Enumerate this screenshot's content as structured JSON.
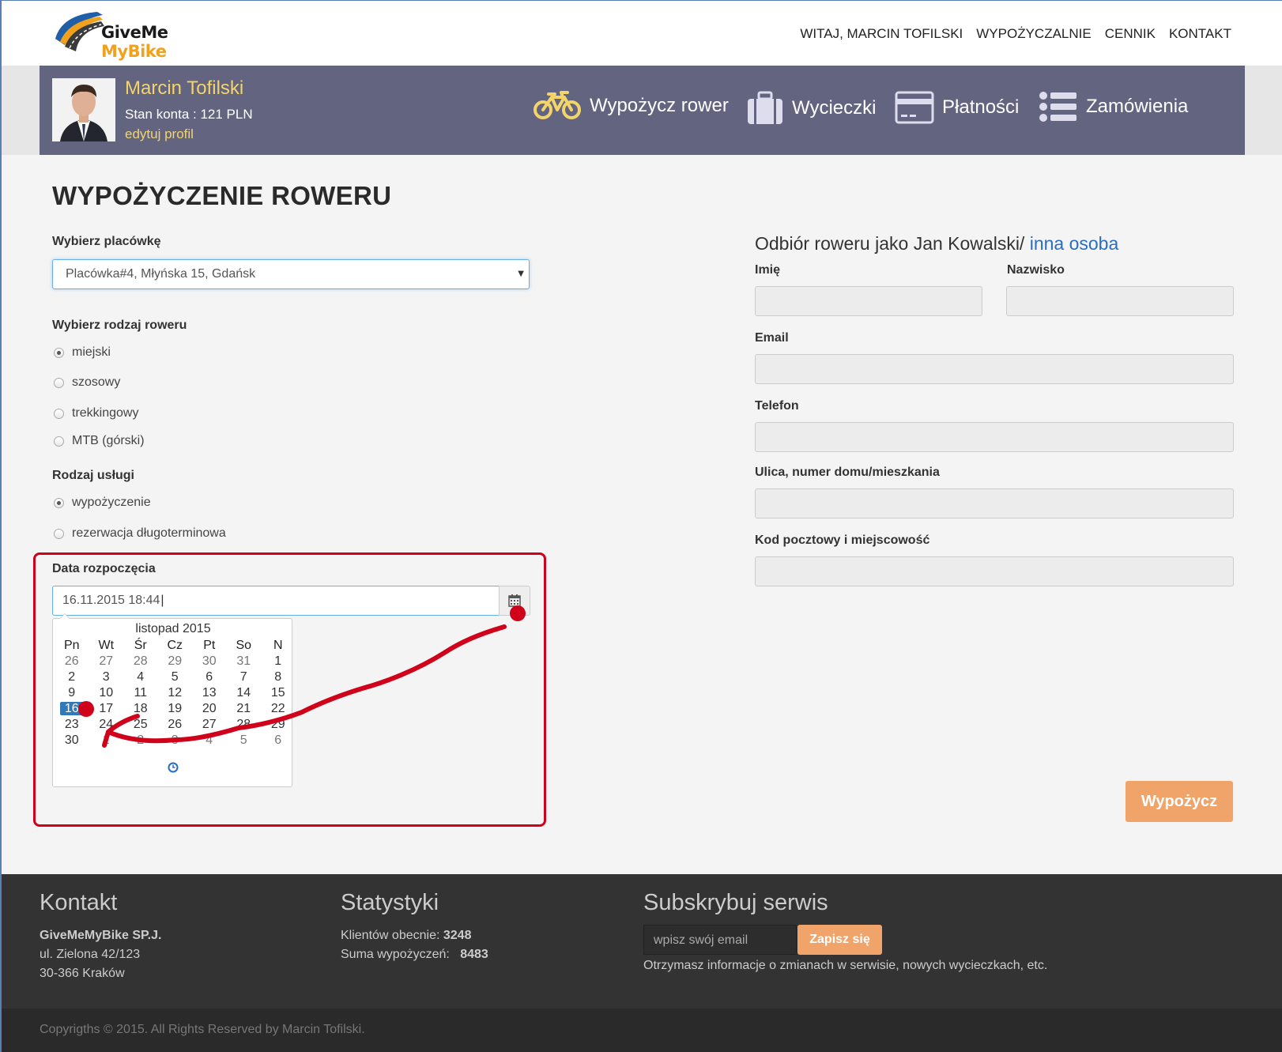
{
  "brand": {
    "line1": "GiveMe",
    "line2": "MyBike"
  },
  "topnav": [
    "WITAJ, MARCIN TOFILSKI",
    "WYPOŻYCZALNIE",
    "CENNIK",
    "KONTAKT"
  ],
  "user": {
    "name": "Marcin Tofilski",
    "balance": "Stan konta : 121 PLN",
    "edit": "edytuj profil"
  },
  "usernav": [
    {
      "label": "Wypożycz rower",
      "icon": "bicycle-icon"
    },
    {
      "label": "Wycieczki",
      "icon": "suitcase-icon"
    },
    {
      "label": "Płatności",
      "icon": "credit-card-icon"
    },
    {
      "label": "Zamówienia",
      "icon": "list-icon"
    }
  ],
  "page": {
    "title": "WYPOŻYCZENIE ROWERU"
  },
  "branch": {
    "label": "Wybierz placówkę",
    "value": "Placówka#4, Młyńska 15, Gdańsk"
  },
  "bike_type": {
    "label": "Wybierz rodzaj roweru",
    "options": [
      "miejski",
      "szosowy",
      "trekkingowy",
      "MTB (górski)"
    ],
    "selected": "miejski"
  },
  "service": {
    "label": "Rodzaj usługi",
    "options": [
      "wypożyczenie",
      "rezerwacja długoterminowa"
    ],
    "selected": "wypożyczenie"
  },
  "start_date": {
    "label": "Data rozpoczęcia",
    "value": "16.11.2015 18:44"
  },
  "calendar": {
    "month": "listopad 2015",
    "weekdays": [
      "Pn",
      "Wt",
      "Śr",
      "Cz",
      "Pt",
      "So",
      "N"
    ],
    "weeks": [
      [
        "26",
        "27",
        "28",
        "29",
        "30",
        "31",
        "1"
      ],
      [
        "2",
        "3",
        "4",
        "5",
        "6",
        "7",
        "8"
      ],
      [
        "9",
        "10",
        "11",
        "12",
        "13",
        "14",
        "15"
      ],
      [
        "16",
        "17",
        "18",
        "19",
        "20",
        "21",
        "22"
      ],
      [
        "23",
        "24",
        "25",
        "26",
        "27",
        "28",
        "29"
      ],
      [
        "30",
        "1",
        "2",
        "3",
        "4",
        "5",
        "6"
      ]
    ],
    "selected": "16"
  },
  "pickup": {
    "title": "Odbiór roweru jako Jan Kowalski/ ",
    "other_link": "inna osoba",
    "fields": {
      "first_name": "Imię",
      "last_name": "Nazwisko",
      "email": "Email",
      "phone": "Telefon",
      "street": "Ulica, numer domu/mieszkania",
      "postal": "Kod pocztowy i miejscowość"
    }
  },
  "submit_label": "Wypożycz",
  "footer": {
    "contact_title": "Kontakt",
    "company": "GiveMeMyBike SP.J.",
    "street": "ul. Zielona 42/123",
    "city": "30-366 Kraków",
    "stats_title": "Statystyki",
    "clients_label": "Klientów obecnie:",
    "clients_value": "3248",
    "rentals_label": "Suma wypożyczeń:",
    "rentals_value": "8483",
    "subscribe_title": "Subskrybuj serwis",
    "email_placeholder": "wpisz swój email",
    "subscribe_button": "Zapisz się",
    "subscribe_note": "Otrzymasz informacje o zmianach w serwisie, nowych wycieczkach, etc."
  },
  "copyright": "Copyrigths © 2015. All Rights Reserved by Marcin Tofilski.",
  "colors": {
    "accent": "#f0a46a",
    "userbar": "#636480",
    "annotation": "#d0021b",
    "link": "#2a6dbf"
  }
}
